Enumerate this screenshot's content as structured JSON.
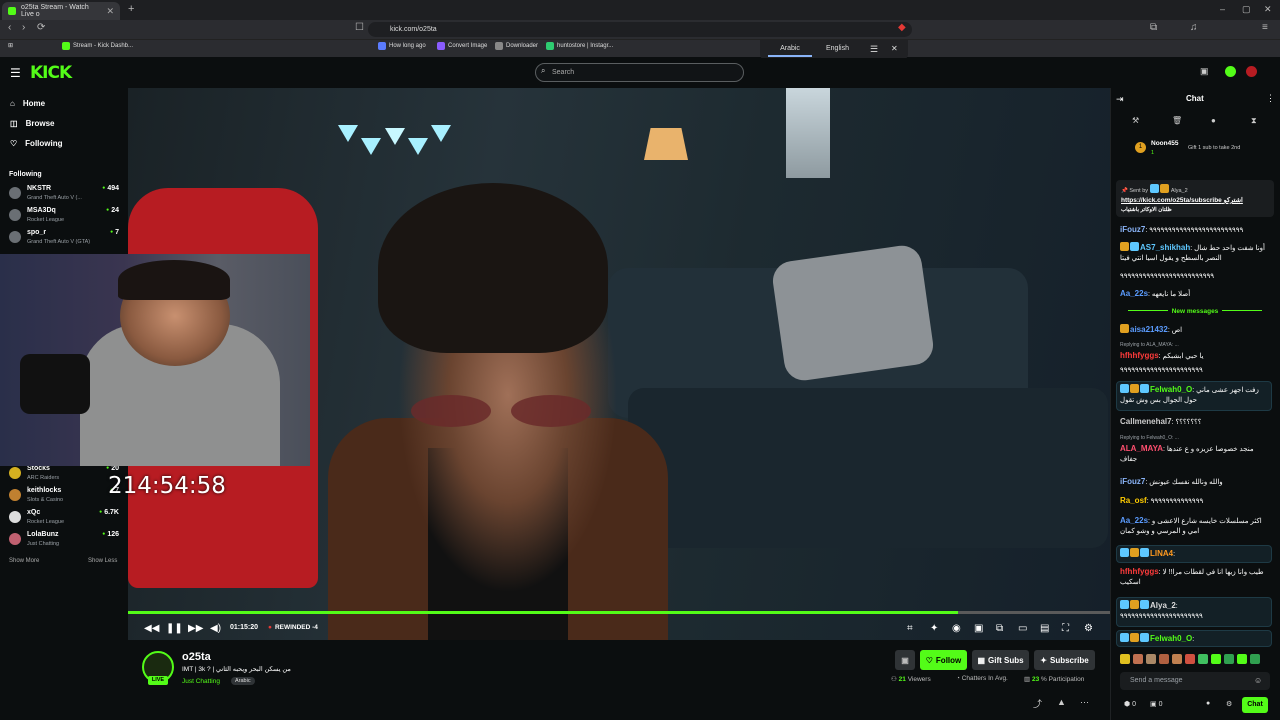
{
  "browser": {
    "tab_title": "o25ta Stream - Watch Live o",
    "url": "kick.com/o25ta",
    "bookmarks": [
      "Stream - Kick Dashb...",
      "How long ago",
      "Convert Image",
      "Downloader",
      "huntostore | Instagr..."
    ],
    "translate": {
      "lang1": "Arabic",
      "lang2": "English"
    }
  },
  "header": {
    "logo": "KICK",
    "search_placeholder": "Search"
  },
  "sidebar": {
    "nav": [
      {
        "label": "Home",
        "icon": "home-icon"
      },
      {
        "label": "Browse",
        "icon": "compass-icon"
      },
      {
        "label": "Following",
        "icon": "heart-icon"
      }
    ],
    "following_title": "Following",
    "channels_top": [
      {
        "name": "NKSTR",
        "game": "Grand Theft Auto V (...",
        "viewers": "494"
      },
      {
        "name": "MSA3Dq",
        "game": "Rocket League",
        "viewers": "24"
      },
      {
        "name": "spo_r",
        "game": "Grand Theft Auto V (GTA)",
        "viewers": "7"
      }
    ],
    "channels_bottom": [
      {
        "name": "Stocks",
        "game": "ARC Raiders",
        "viewers": "20"
      },
      {
        "name": "keithlocks",
        "game": "Slots & Casino",
        "viewers": "7"
      },
      {
        "name": "xQc",
        "game": "Rocket League",
        "viewers": "6.7K"
      },
      {
        "name": "LolaBunz",
        "game": "Just Chatting",
        "viewers": "126"
      }
    ],
    "show_more": "Show More",
    "show_less": "Show Less"
  },
  "video": {
    "overlay_timer": "214:54:58",
    "time": "01:15:20",
    "rewound": "REWINDED -4",
    "progress": 0.845
  },
  "stream": {
    "name": "o25ta",
    "title": "IMT | 3k ? | من يسكن البحر ويحبه الثاني",
    "category": "Just Chatting",
    "tag": "Arabic",
    "live": "LIVE",
    "buttons": {
      "follow": "Follow",
      "gift": "Gift Subs",
      "subscribe": "Subscribe"
    },
    "viewers": "21",
    "viewers_label": "Viewers",
    "chatters_label": "Chatters In Avg.",
    "participation": "23",
    "participation_label": "% Participation"
  },
  "chat": {
    "title": "Chat",
    "leader": {
      "rank": "1",
      "name": "Noon455",
      "sub": "1",
      "gift_note": "Gift 1 sub to take 2nd"
    },
    "pinned": {
      "sent_by": "Sent by",
      "sender": "Alya_2",
      "link": "https://kick.com/o25ta/subscribe",
      "text1": "اشتركو",
      "text2": "ظلتان الاوكاتر باشتياب"
    },
    "new_messages": "New messages",
    "messages": [
      {
        "user": "iFouz7",
        "color": "#8ab4f8",
        "text": "٩٩٩٩٩٩٩٩٩٩٩٩٩٩٩٩٩٩٩٩٩٩٩٩٩"
      },
      {
        "user": "AS7_shikhah",
        "color": "#5ec8ff",
        "text": "أونا شفت واحد حط شال النصر بالسطح و يقول اسيا انتي فيتا"
      },
      {
        "user": "Aa_22s",
        "color": "#5b9cff",
        "text": "أصلا ما نايعهه"
      },
      {
        "user": "aisa21432",
        "color": "#5b9cff",
        "text": "اص"
      },
      {
        "user": "hfhhfyggs",
        "color": "#ff3b3b",
        "text": "يا حبي ابشبكم"
      },
      {
        "user": "Felwah0_O",
        "color": "#53fc18",
        "text": "زفت اجهز عشى ماني حول الجوال بس وش تقول"
      },
      {
        "user": "Callmenehal7",
        "color": "#ccc",
        "text": "؟؟؟؟؟؟؟"
      },
      {
        "user": "ALA_MAYA",
        "color": "#ff4f6f",
        "text": "منجد خصوصا عزيزه و ع عندها جفاف"
      },
      {
        "user": "iFouz7",
        "color": "#8ab4f8",
        "text": "والله ونالله نفسك عيونش"
      },
      {
        "user": "Ra_osf",
        "color": "#ffcc00",
        "text": "٩٩٩٩٩٩٩٩٩٩٩٩٩٩"
      },
      {
        "user": "Aa_22s",
        "color": "#5b9cff",
        "text": "اكثر مسلسلات خايسه شارع الاعشى و امي و المرسي و وشو كمان"
      },
      {
        "user": "LINA4",
        "color": "#ff9a1f",
        "text": ""
      },
      {
        "user": "hfhhfyggs",
        "color": "#ff3b3b",
        "text": "طيب وانا زيها انا في لقطات مرا!! لا اسكيب"
      },
      {
        "user": "Alya_2",
        "color": "#ddd",
        "text": "٩٩٩٩٩٩٩٩٩٩٩٩٩٩٩٩٩٩٩٩٩٩"
      },
      {
        "user": "Felwah0_O",
        "color": "#53fc18",
        "text": ""
      }
    ],
    "reply1": "Replying to ALA_MAYA: ...",
    "reply2": "Replying to Felwah0_O: ...",
    "reply3": "Replying to ...",
    "input_placeholder": "Send a message",
    "send": "Chat",
    "points": "0",
    "count": "0"
  }
}
